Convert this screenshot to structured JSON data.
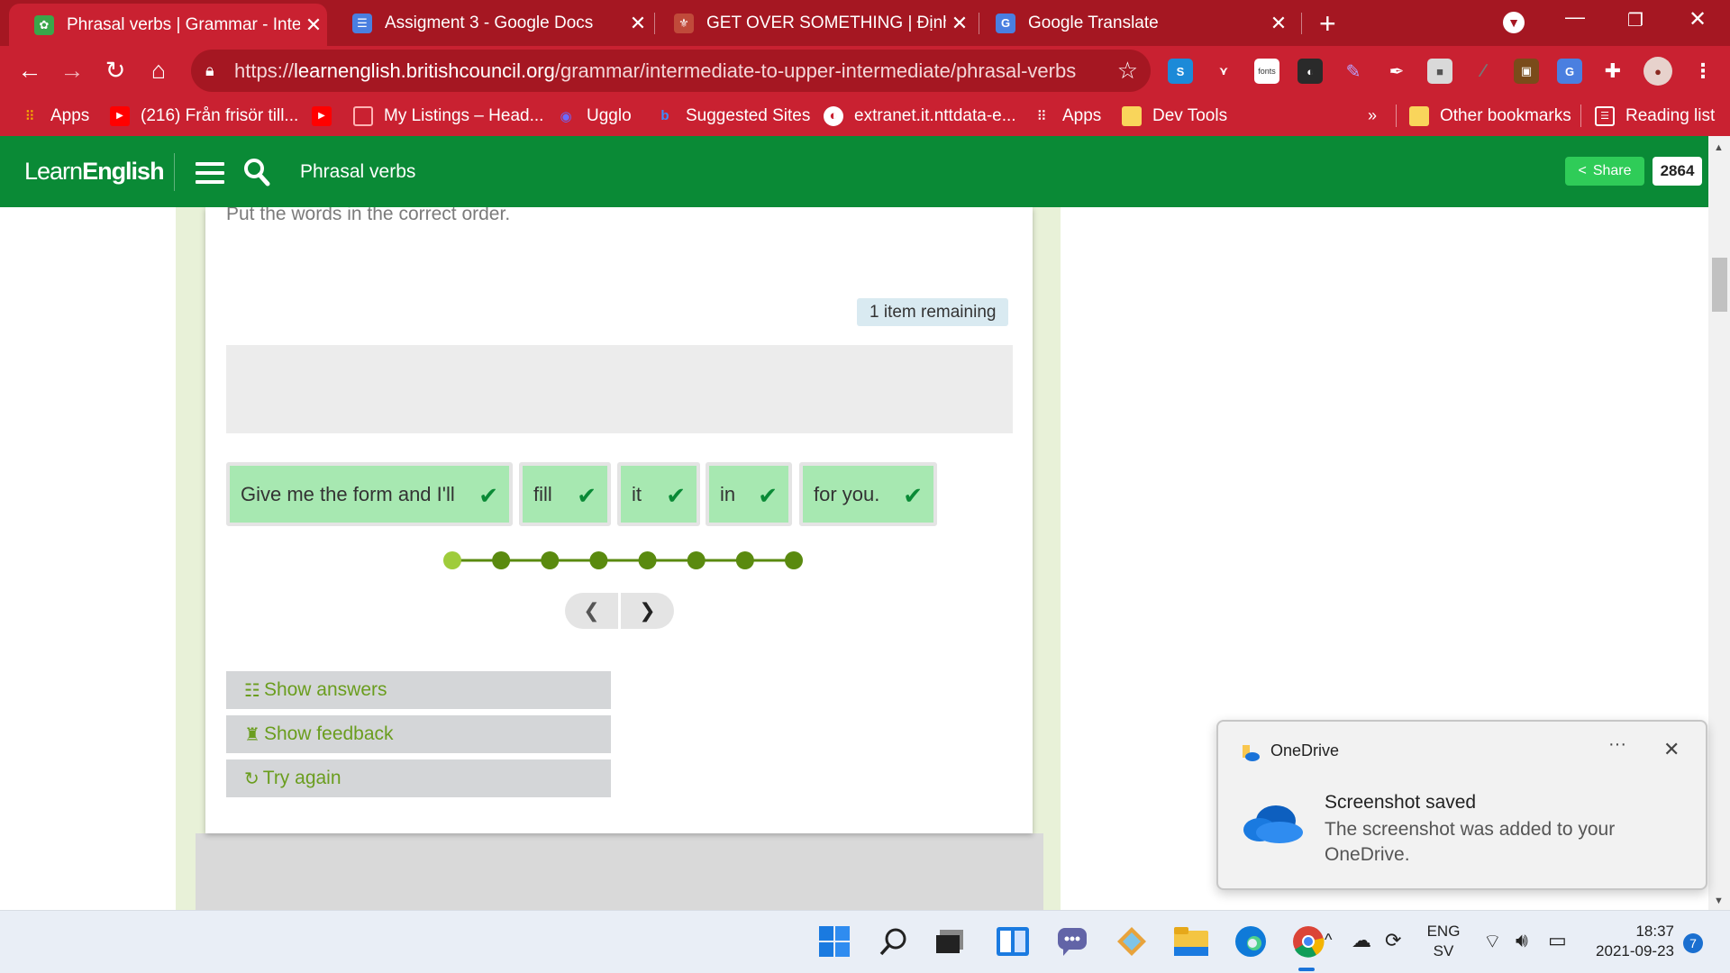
{
  "browser": {
    "tabs": [
      {
        "title": "Phrasal verbs | Grammar - Interm",
        "favicon": "learnenglish-favicon",
        "active": true
      },
      {
        "title": "Assigment 3 - Google Docs",
        "favicon": "google-docs-icon",
        "active": false
      },
      {
        "title": "GET OVER SOMETHING | Định ng",
        "favicon": "cambridge-icon",
        "active": false
      },
      {
        "title": "Google Translate",
        "favicon": "google-translate-icon",
        "active": false
      }
    ],
    "new_tab_label": "+",
    "url_prefix": "https://",
    "url_domain": "learnenglish.britishcouncil.org",
    "url_path": "/grammar/intermediate-to-upper-intermediate/phrasal-verbs",
    "bookmarks": [
      {
        "label": "Apps",
        "icon": "apps-grid-icon"
      },
      {
        "label": "(216) Från frisör till...",
        "icon": "youtube-icon"
      },
      {
        "label": "",
        "icon": "youtube-icon"
      },
      {
        "label": "My Listings – Head...",
        "icon": "listings-icon"
      },
      {
        "label": "Ugglo",
        "icon": "ugglo-icon"
      },
      {
        "label": "Suggested Sites",
        "icon": "bing-icon"
      },
      {
        "label": "extranet.it.nttdata-e...",
        "icon": "globe-icon"
      },
      {
        "label": "Apps",
        "icon": "apps-grid-icon"
      },
      {
        "label": "Dev Tools",
        "icon": "folder-icon"
      }
    ],
    "overflow_label": "»",
    "other_bookmarks": "Other bookmarks",
    "reading_list": "Reading list"
  },
  "site": {
    "logo_light": "Learn",
    "logo_bold": "English",
    "header_title": "Phrasal verbs",
    "share_label": "Share",
    "share_count": "2864"
  },
  "exercise": {
    "instruction": "Put the words in the correct order.",
    "remaining": "1 item remaining",
    "words": [
      {
        "text": "Give me the form and I'll",
        "correct": true
      },
      {
        "text": "fill",
        "correct": true
      },
      {
        "text": "it",
        "correct": true
      },
      {
        "text": "in",
        "correct": true
      },
      {
        "text": "for you.",
        "correct": true
      }
    ],
    "progress": {
      "total": 8,
      "current": 1
    },
    "buttons": {
      "show_answers": "Show answers",
      "show_feedback": "Show feedback",
      "try_again": "Try again"
    }
  },
  "notification": {
    "app": "OneDrive",
    "title": "Screenshot saved",
    "body": "The screenshot was added to your OneDrive.",
    "more": "···"
  },
  "taskbar": {
    "lang_top": "ENG",
    "lang_bottom": "SV",
    "time": "18:37",
    "date": "2021-09-23",
    "badge": "7"
  },
  "colors": {
    "chrome_red": "#c92131",
    "site_green": "#0a8a36",
    "word_correct": "#a7e8b1",
    "progress_done": "#5a8a0f",
    "progress_current": "#9fcc3b"
  }
}
